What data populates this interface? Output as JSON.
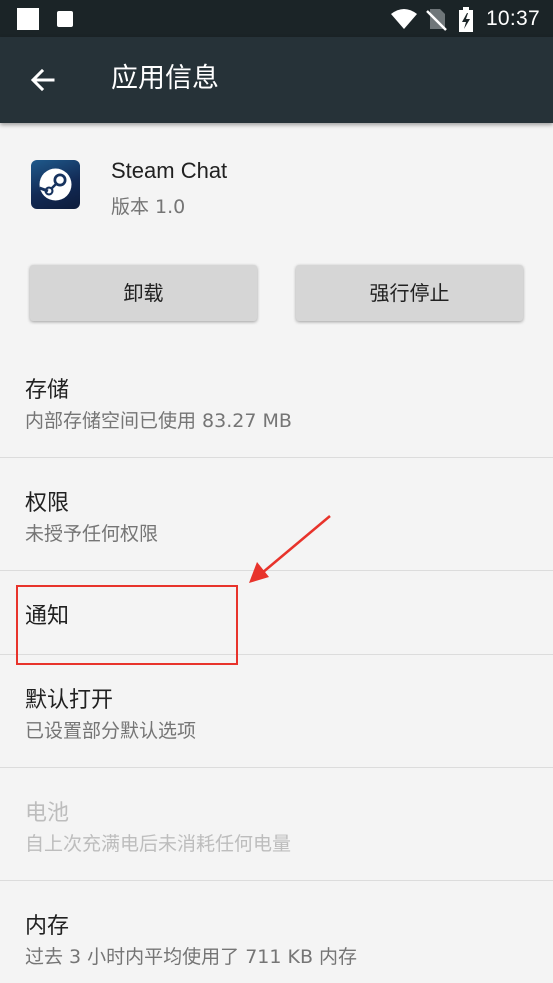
{
  "status_bar": {
    "time": "10:37",
    "icons": [
      "wifi-icon",
      "no-sim-icon",
      "battery-charging-icon"
    ]
  },
  "app_bar": {
    "title": "应用信息",
    "back_icon": "arrow-back-icon"
  },
  "app": {
    "name": "Steam Chat",
    "version": "版本 1.0",
    "icon": "steam-logo-icon"
  },
  "buttons": {
    "uninstall": "卸载",
    "force_stop": "强行停止"
  },
  "items": [
    {
      "title": "存储",
      "subtitle": "内部存储空间已使用 83.27 MB",
      "enabled": true
    },
    {
      "title": "权限",
      "subtitle": "未授予任何权限",
      "enabled": true
    },
    {
      "title": "通知",
      "subtitle": "",
      "enabled": true
    },
    {
      "title": "默认打开",
      "subtitle": "已设置部分默认选项",
      "enabled": true
    },
    {
      "title": "电池",
      "subtitle": "自上次充满电后未消耗任何电量",
      "enabled": false
    },
    {
      "title": "内存",
      "subtitle": "过去 3 小时内平均使用了 711 KB 内存",
      "enabled": true
    }
  ],
  "colors": {
    "status_bar": "#1b2427",
    "app_bar": "#263238",
    "background": "#f4f4f4",
    "button": "#d6d6d6",
    "annotation": "#e8332b"
  }
}
